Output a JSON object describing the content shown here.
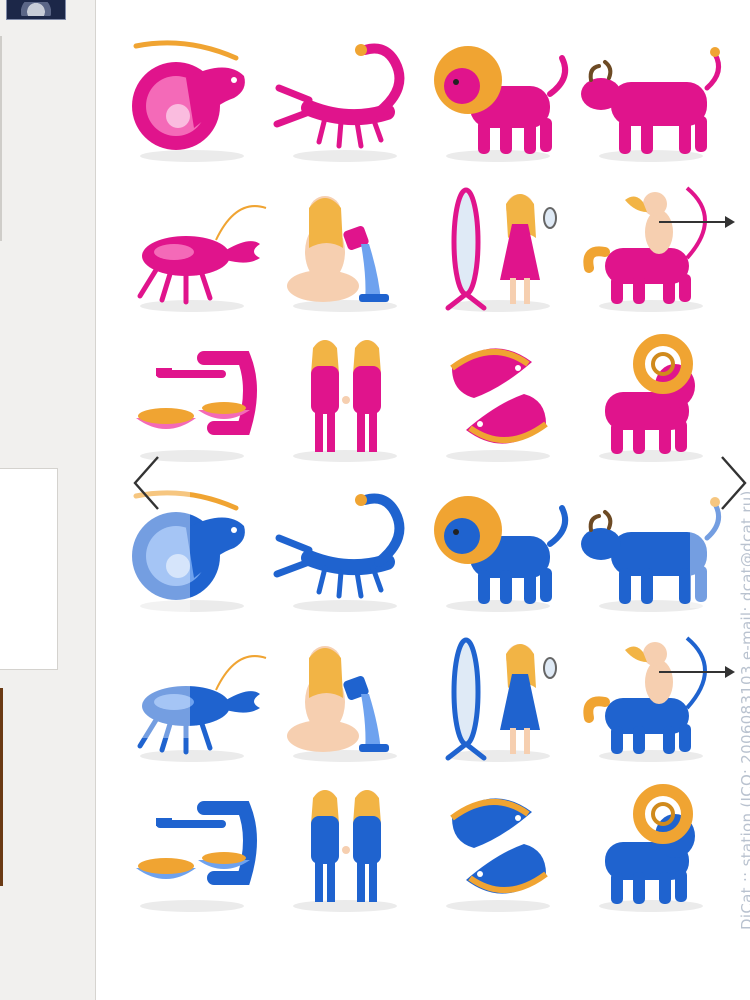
{
  "watermark": "DiCat :: station  (ICO: 2006083103  e-mail: dcat@dcat.ru)",
  "colors": {
    "pink": "#e0148c",
    "pink_light": "#f46ab8",
    "blue": "#1f63cf",
    "blue_light": "#6ea2ef",
    "mane": "#f0a432",
    "skin": "#f6cfb0",
    "hair": "#f2b445"
  },
  "icons": [
    {
      "name": "capricorn-pink-icon",
      "sign": "capricorn",
      "color": "pink"
    },
    {
      "name": "scorpio-pink-icon",
      "sign": "scorpio",
      "color": "pink"
    },
    {
      "name": "leo-pink-icon",
      "sign": "leo",
      "color": "pink"
    },
    {
      "name": "taurus-pink-icon",
      "sign": "taurus",
      "color": "pink"
    },
    {
      "name": "cancer-pink-icon",
      "sign": "cancer",
      "color": "pink"
    },
    {
      "name": "aquarius-pink-icon",
      "sign": "aquarius",
      "color": "pink"
    },
    {
      "name": "virgo-pink-icon",
      "sign": "virgo",
      "color": "pink"
    },
    {
      "name": "sagittarius-pink-icon",
      "sign": "sagittarius",
      "color": "pink"
    },
    {
      "name": "libra-pink-icon",
      "sign": "libra",
      "color": "pink"
    },
    {
      "name": "gemini-pink-icon",
      "sign": "gemini",
      "color": "pink"
    },
    {
      "name": "pisces-pink-icon",
      "sign": "pisces",
      "color": "pink"
    },
    {
      "name": "aries-pink-icon",
      "sign": "aries",
      "color": "pink"
    },
    {
      "name": "capricorn-blue-icon",
      "sign": "capricorn",
      "color": "blue"
    },
    {
      "name": "scorpio-blue-icon",
      "sign": "scorpio",
      "color": "blue"
    },
    {
      "name": "leo-blue-icon",
      "sign": "leo",
      "color": "blue"
    },
    {
      "name": "taurus-blue-icon",
      "sign": "taurus",
      "color": "blue"
    },
    {
      "name": "cancer-blue-icon",
      "sign": "cancer",
      "color": "blue"
    },
    {
      "name": "aquarius-blue-icon",
      "sign": "aquarius",
      "color": "blue"
    },
    {
      "name": "virgo-blue-icon",
      "sign": "virgo",
      "color": "blue"
    },
    {
      "name": "sagittarius-blue-icon",
      "sign": "sagittarius",
      "color": "blue"
    },
    {
      "name": "libra-blue-icon",
      "sign": "libra",
      "color": "blue"
    },
    {
      "name": "gemini-blue-icon",
      "sign": "gemini",
      "color": "blue"
    },
    {
      "name": "pisces-blue-icon",
      "sign": "pisces",
      "color": "blue"
    },
    {
      "name": "aries-blue-icon",
      "sign": "aries",
      "color": "blue"
    }
  ],
  "nav": {
    "prev_icon": "chevron-left-icon",
    "next_icon": "chevron-right-icon"
  }
}
